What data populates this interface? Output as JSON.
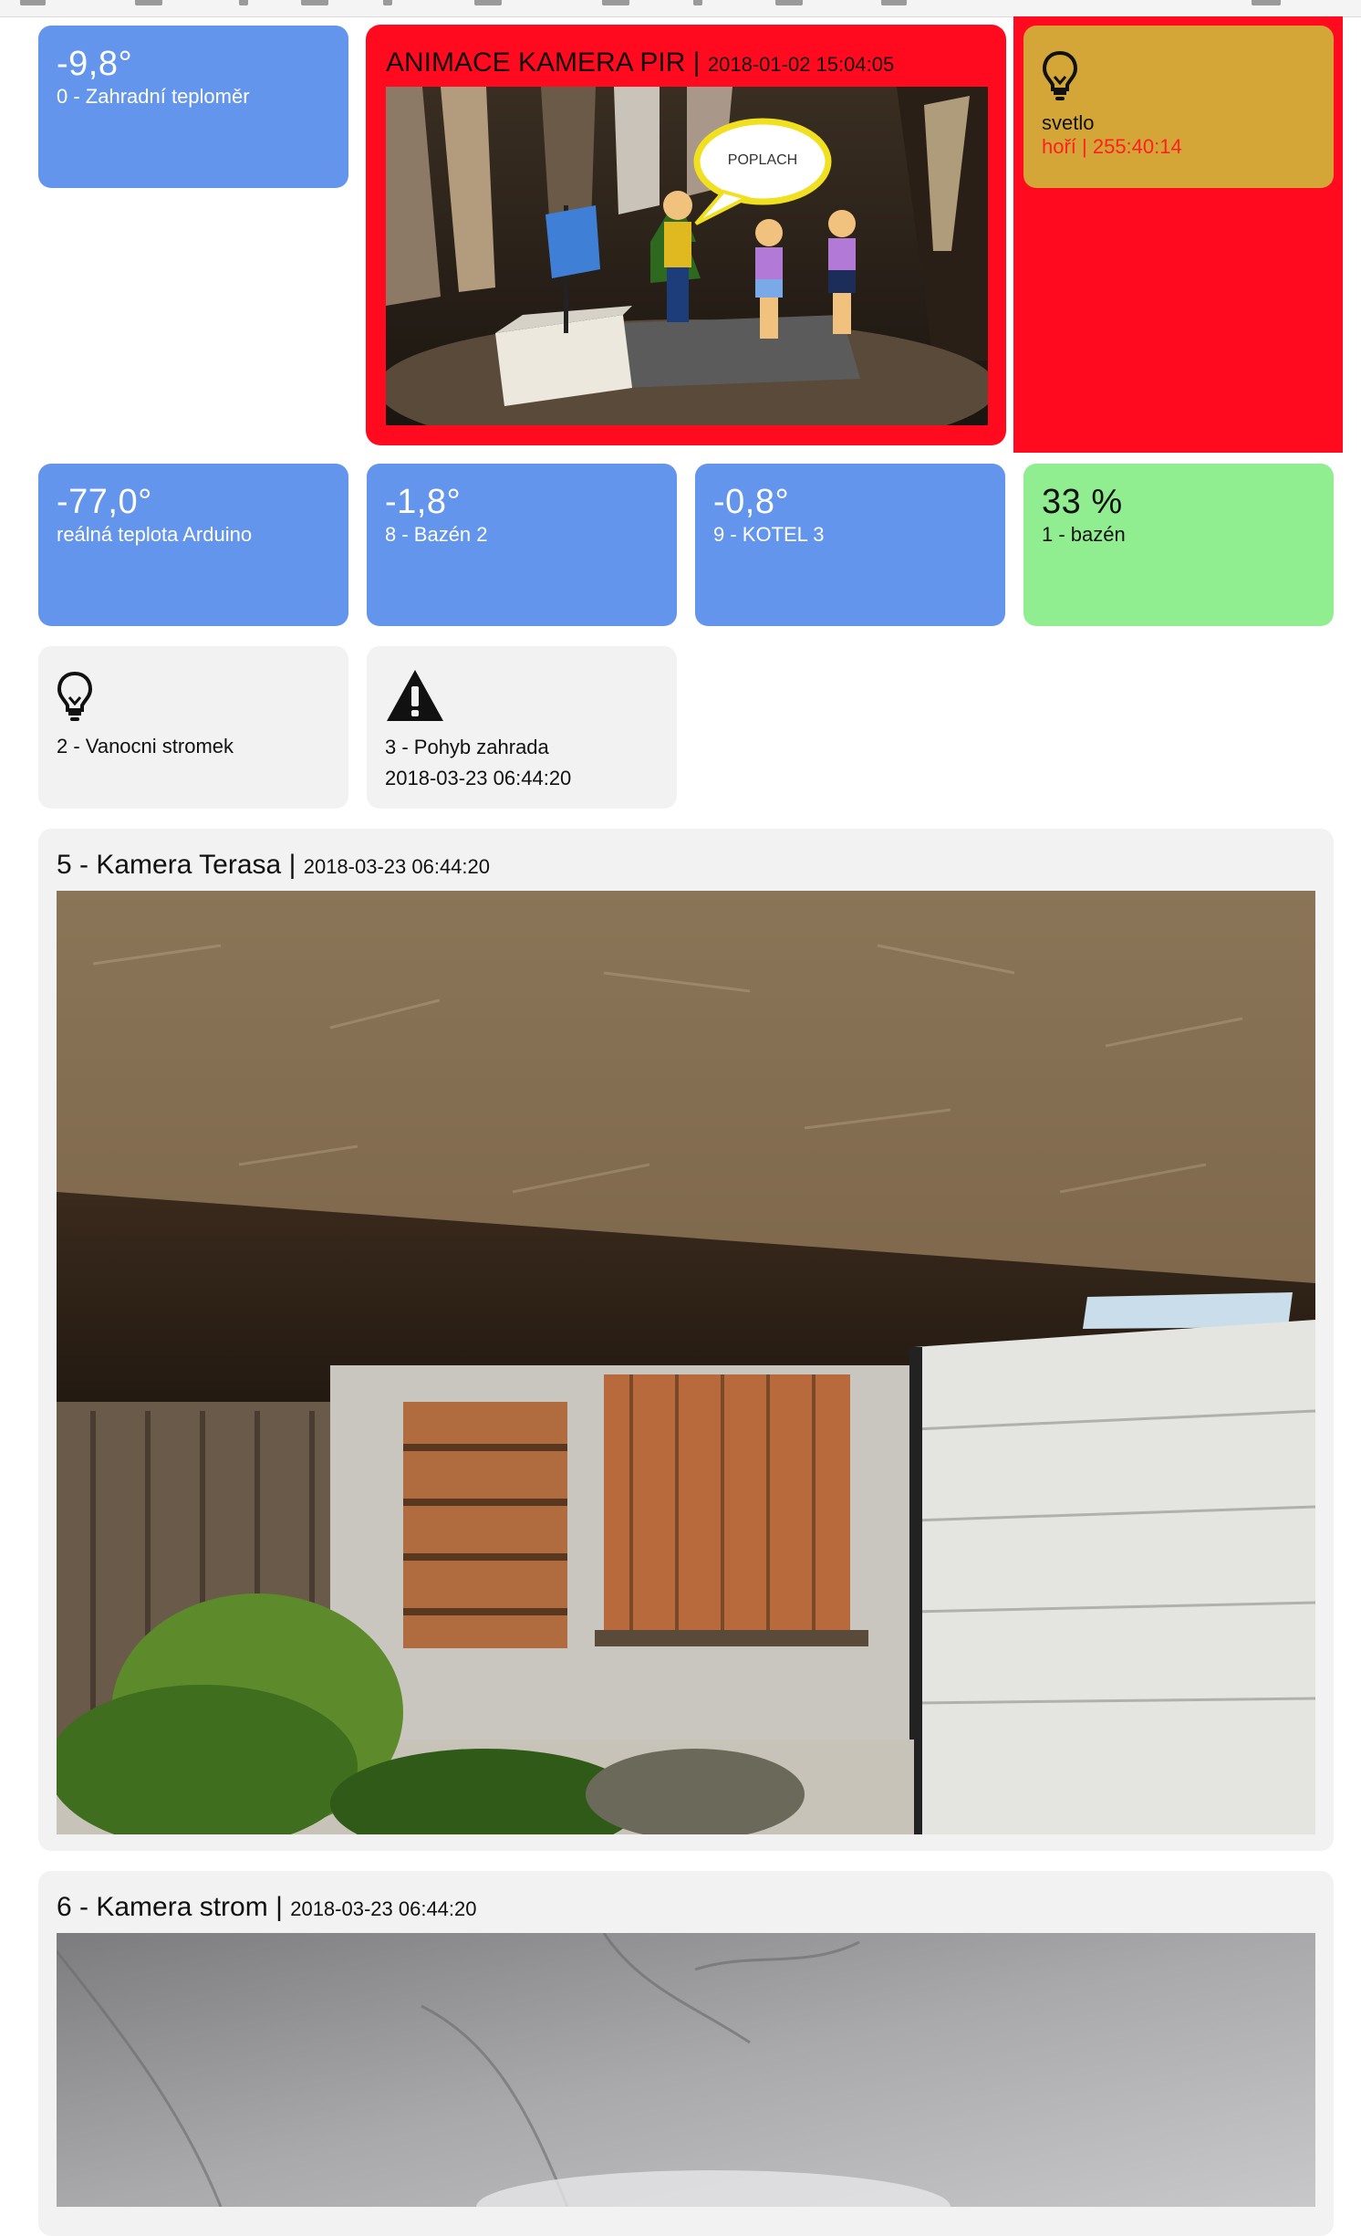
{
  "tiles": {
    "garden_temp": {
      "value": "-9,8°",
      "label": "0 - Zahradní teploměr"
    },
    "arduino_temp": {
      "value": "-77,0°",
      "label": "reálná teplota Arduino"
    },
    "pool2_temp": {
      "value": "-1,8°",
      "label": "8 - Bazén 2"
    },
    "boiler_temp": {
      "value": "-0,8°",
      "label": "9 - KOTEL 3"
    },
    "pool_level": {
      "value": "33 %",
      "label": "1 - bazén"
    },
    "light": {
      "label": "svetlo",
      "status": "hoří | 255:40:14",
      "icon": "lightbulb-icon"
    },
    "xmas_tree": {
      "label": "2 - Vanocni stromek",
      "icon": "lightbulb-icon"
    },
    "motion_garden": {
      "label": "3 - Pohyb zahrada",
      "time": "2018-03-23 06:44:20",
      "icon": "warning-icon"
    }
  },
  "alarm_camera": {
    "title": "ANIMACE KAMERA PIR",
    "separator": "|",
    "timestamp": "2018-01-02 15:04:05",
    "bubble_text": "POPLACH"
  },
  "cameras": [
    {
      "title": "5 - Kamera Terasa",
      "separator": "|",
      "timestamp": "2018-03-23 06:44:20"
    },
    {
      "title": "6 - Kamera strom",
      "separator": "|",
      "timestamp": "2018-03-23 06:44:20"
    }
  ],
  "colors": {
    "blue_tile": "#6495ed",
    "green_tile": "#90ee90",
    "grey_tile": "#f2f2f2",
    "gold_tile": "#d4a537",
    "alarm_red": "#ff0a1e"
  }
}
